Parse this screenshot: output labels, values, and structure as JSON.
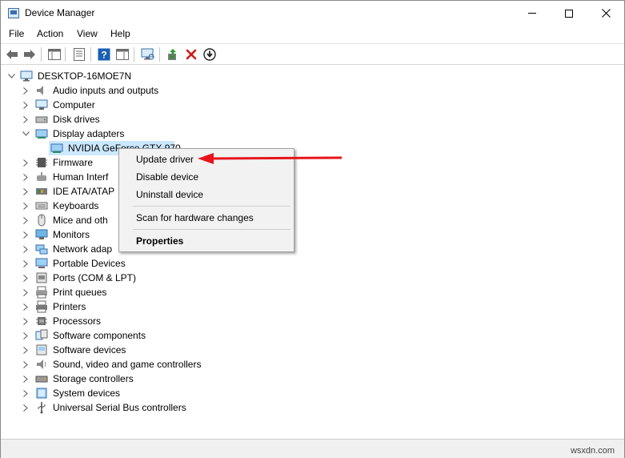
{
  "window": {
    "title": "Device Manager",
    "controls": {
      "minimize": "minimize",
      "maximize": "maximize",
      "close": "close"
    }
  },
  "menu": {
    "file": "File",
    "action": "Action",
    "view": "View",
    "help": "Help"
  },
  "toolbar": {
    "icons": [
      "back-arrow-icon",
      "forward-arrow-icon",
      "show-hide-console-tree-icon",
      "properties-icon",
      "help-icon",
      "show-hide-action-pane-icon",
      "scan-hardware-icon",
      "update-driver-icon",
      "uninstall-device-icon",
      "disable-device-icon"
    ]
  },
  "tree": {
    "root": "DESKTOP-16MOE7N",
    "categories": [
      {
        "label": "Audio inputs and outputs",
        "icon": "speaker-icon"
      },
      {
        "label": "Computer",
        "icon": "computer-icon"
      },
      {
        "label": "Disk drives",
        "icon": "disk-drive-icon"
      },
      {
        "label": "Display adapters",
        "icon": "display-adapter-icon",
        "expanded": true
      },
      {
        "label": "Firmware",
        "icon": "firmware-icon"
      },
      {
        "label": "Human Interf",
        "icon": "hid-icon"
      },
      {
        "label": "IDE ATA/ATAP",
        "icon": "ide-icon"
      },
      {
        "label": "Keyboards",
        "icon": "keyboard-icon"
      },
      {
        "label": "Mice and oth",
        "icon": "mouse-icon"
      },
      {
        "label": "Monitors",
        "icon": "monitor-icon"
      },
      {
        "label": "Network adap",
        "icon": "network-adapter-icon"
      },
      {
        "label": "Portable Devices",
        "icon": "portable-device-icon"
      },
      {
        "label": "Ports (COM & LPT)",
        "icon": "port-icon"
      },
      {
        "label": "Print queues",
        "icon": "print-queue-icon"
      },
      {
        "label": "Printers",
        "icon": "printer-icon"
      },
      {
        "label": "Processors",
        "icon": "processor-icon"
      },
      {
        "label": "Software components",
        "icon": "software-component-icon"
      },
      {
        "label": "Software devices",
        "icon": "software-device-icon"
      },
      {
        "label": "Sound, video and game controllers",
        "icon": "sound-controller-icon"
      },
      {
        "label": "Storage controllers",
        "icon": "storage-controller-icon"
      },
      {
        "label": "System devices",
        "icon": "system-device-icon"
      },
      {
        "label": "Universal Serial Bus controllers",
        "icon": "usb-icon"
      }
    ],
    "selected_device": "NVIDIA GeForce GTX 970"
  },
  "context_menu": {
    "update_driver": "Update driver",
    "disable_device": "Disable device",
    "uninstall_device": "Uninstall device",
    "scan_hardware": "Scan for hardware changes",
    "properties": "Properties"
  },
  "annotation": {
    "arrow_color": "#e8141c"
  },
  "watermark": "wsxdn.com",
  "colors": {
    "selection": "#cce8ff",
    "menu_bg": "#f2f2f2",
    "accent": "#1a73c8"
  }
}
